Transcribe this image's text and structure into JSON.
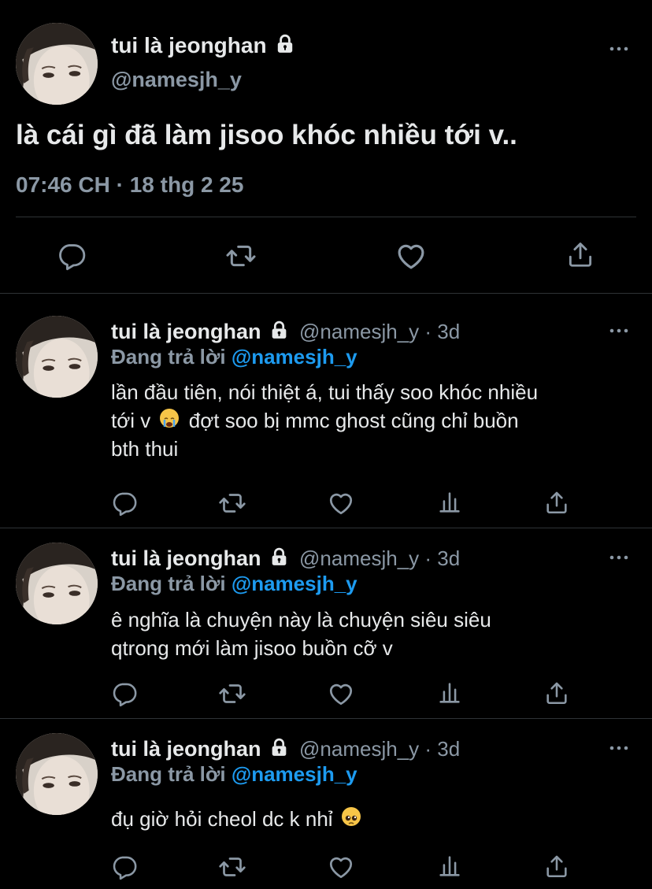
{
  "main_tweet": {
    "display_name": "tui là jeonghan",
    "handle": "@namesjh_y",
    "text": "là cái gì đã làm jisoo khóc nhiều tới v..",
    "timestamp": "07:46 CH · 18 thg 2 25"
  },
  "replies": [
    {
      "display_name": "tui là jeonghan",
      "meta": "@namesjh_y · 3d",
      "reply_prefix": "Đang trả lời",
      "reply_mention": "@namesjh_y",
      "line1": "lần đầu tiên, nói thiệt á, tui thấy soo khóc nhiều",
      "line2a": "tới v",
      "emoji": "loudly-crying-face",
      "line2b": "đợt soo bị mmc ghost cũng chỉ buồn",
      "line3": "bth thui"
    },
    {
      "display_name": "tui là jeonghan",
      "meta": "@namesjh_y · 3d",
      "reply_prefix": "Đang trả lời",
      "reply_mention": "@namesjh_y",
      "line1": "ê nghĩa là chuyện này là chuyện siêu siêu",
      "line2": "qtrong mới làm jisoo buồn cỡ v"
    },
    {
      "display_name": "tui là jeonghan",
      "meta": "@namesjh_y · 3d",
      "reply_prefix": "Đang trả lời",
      "reply_mention": "@namesjh_y",
      "line1": "đụ giờ hỏi cheol dc k nhỉ",
      "emoji": "pleading-face"
    }
  ],
  "icons": [
    "reply-icon",
    "retweet-icon",
    "like-icon",
    "analytics-icon",
    "share-icon",
    "lock-icon",
    "more-icon"
  ],
  "colors": {
    "background": "#000000",
    "text": "#e7e9ea",
    "muted": "#8b98a5",
    "accent": "#1d9bf0",
    "divider": "#2f3336"
  }
}
